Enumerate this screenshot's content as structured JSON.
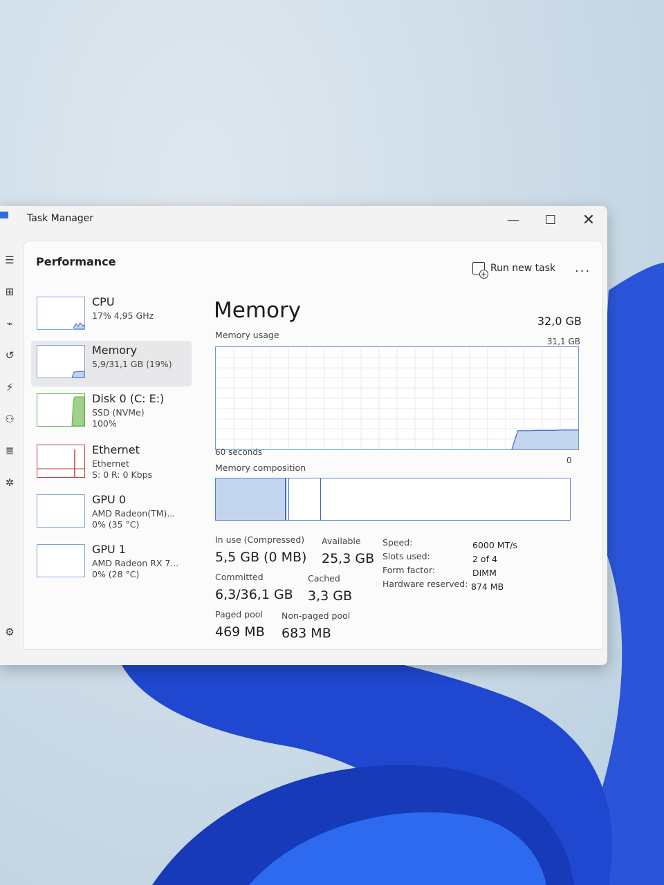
{
  "window": {
    "title": "Task Manager"
  },
  "header": {
    "page_title": "Performance",
    "run_new_task": "Run new task",
    "more": "..."
  },
  "devices": [
    {
      "name": "CPU",
      "sub1": "17% 4,95 GHz",
      "sub2": ""
    },
    {
      "name": "Memory",
      "sub1": "5,9/31,1 GB (19%)",
      "sub2": ""
    },
    {
      "name": "Disk 0 (C: E:)",
      "sub1": "SSD (NVMe)",
      "sub2": "100%"
    },
    {
      "name": "Ethernet",
      "sub1": "Ethernet",
      "sub2": "S: 0 R: 0 Kbps"
    },
    {
      "name": "GPU 0",
      "sub1": "AMD Radeon(TM)...",
      "sub2": "0% (35 °C)"
    },
    {
      "name": "GPU 1",
      "sub1": "AMD Radeon RX 7...",
      "sub2": "0% (28 °C)"
    }
  ],
  "memory": {
    "heading": "Memory",
    "total": "32,0 GB",
    "usage_label": "Memory usage",
    "usage_max": "31,1 GB",
    "time_window": "60 seconds",
    "axis_zero": "0",
    "composition_label": "Memory composition",
    "composition": {
      "in_use_fraction": 0.18,
      "modified_fraction": 0.005,
      "standby_fraction": 0.09
    },
    "usage_history_gb": [
      0,
      0,
      0,
      0,
      0,
      0,
      0,
      0,
      0,
      0,
      0,
      0,
      0,
      0,
      0,
      0,
      0,
      0,
      0,
      0,
      0,
      0,
      0,
      0,
      0,
      0,
      0,
      0,
      0,
      0,
      0,
      0,
      0,
      0,
      0,
      0,
      0,
      0,
      0,
      0,
      0,
      0,
      0,
      0,
      0,
      0,
      0,
      0,
      0,
      0,
      5.7,
      5.7,
      5.7,
      5.8,
      5.8,
      5.8,
      5.8,
      5.9,
      5.9,
      5.9,
      5.9
    ]
  },
  "stats": {
    "in_use_label": "In use (Compressed)",
    "in_use_value": "5,5 GB (0 MB)",
    "available_label": "Available",
    "available_value": "25,3 GB",
    "committed_label": "Committed",
    "committed_value": "6,3/36,1 GB",
    "cached_label": "Cached",
    "cached_value": "3,3 GB",
    "paged_label": "Paged pool",
    "paged_value": "469 MB",
    "nonpaged_label": "Non-paged pool",
    "nonpaged_value": "683 MB"
  },
  "specs": [
    {
      "label": "Speed:",
      "value": "6000 MT/s"
    },
    {
      "label": "Slots used:",
      "value": "2 of 4"
    },
    {
      "label": "Form factor:",
      "value": "DIMM"
    },
    {
      "label": "Hardware reserved:",
      "value": "874 MB"
    }
  ],
  "colors": {
    "accent": "#3f66c3",
    "graph_fill": "#c3d4ee",
    "disk_green": "#5fb04a",
    "eth_red": "#c73a3a"
  }
}
